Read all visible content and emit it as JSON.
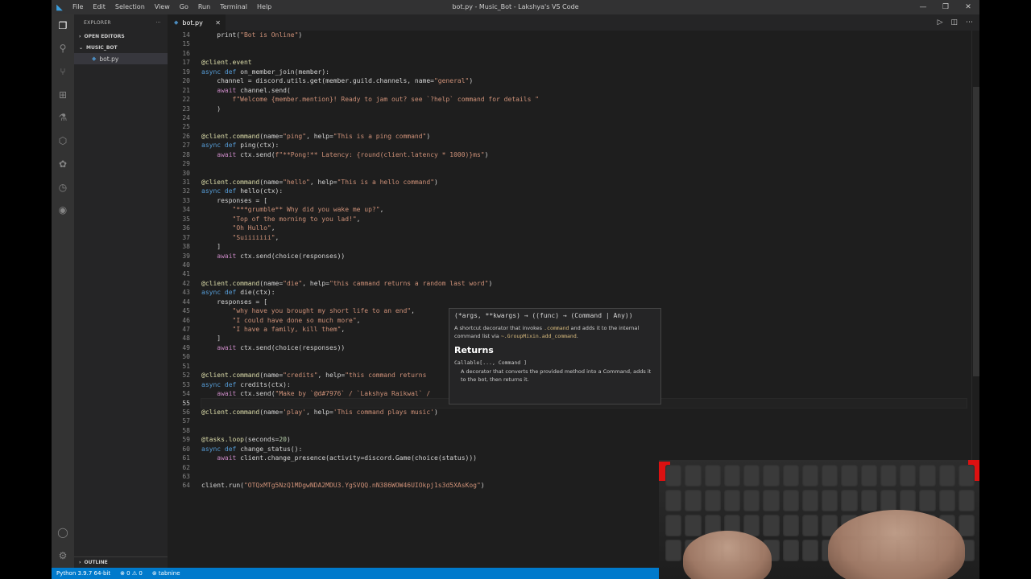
{
  "window": {
    "title": "bot.py - Music_Bot - Lakshya's VS Code",
    "menu": [
      "File",
      "Edit",
      "Selection",
      "View",
      "Go",
      "Run",
      "Terminal",
      "Help"
    ],
    "controls": [
      "—",
      "❐",
      "✕"
    ]
  },
  "activity_icons": [
    "files-icon",
    "search-icon",
    "source-control-icon",
    "extensions-icon",
    "testing-icon",
    "remote-icon",
    "docker-icon",
    "timeline-icon",
    "spotify-icon",
    "account-icon",
    "settings-icon"
  ],
  "sidebar": {
    "title": "EXPLORER",
    "more": "···",
    "open_editors": "OPEN EDITORS",
    "folder": "MUSIC_BOT",
    "file": "bot.py",
    "outline": "OUTLINE"
  },
  "tab": {
    "label": "bot.py",
    "close": "✕"
  },
  "editor": {
    "active_line": 55,
    "line_numbers": [
      "14",
      "15",
      "16",
      "17",
      "19",
      "20",
      "21",
      "22",
      "23",
      "24",
      "25",
      "26",
      "27",
      "28",
      "29",
      "30",
      "31",
      "32",
      "33",
      "34",
      "35",
      "36",
      "37",
      "38",
      "39",
      "40",
      "41",
      "42",
      "43",
      "44",
      "45",
      "46",
      "47",
      "48",
      "49",
      "50",
      "51",
      "52",
      "53",
      "54",
      "55",
      "56",
      "57",
      "58",
      "59",
      "60",
      "61",
      "62",
      "63",
      "64"
    ],
    "lines": [
      "    print(\"Bot is Online\")",
      "",
      "",
      "@client.event",
      "async def on_member_join(member):",
      "    channel = discord.utils.get(member.guild.channels, name=\"general\")",
      "    await channel.send(",
      "        f\"Welcome {member.mention}! Ready to jam out? see `?help` command for details \"",
      "    )",
      "",
      "",
      "@client.command(name=\"ping\", help=\"This is a ping command\")",
      "async def ping(ctx):",
      "    await ctx.send(f\"**Pong!** Latency: {round(client.latency * 1000)}ms\")",
      "",
      "",
      "@client.command(name=\"hello\", help=\"This is a hello command\")",
      "async def hello(ctx):",
      "    responses = [",
      "        \"***grumble** Why did you wake me up?\",",
      "        \"Top of the morning to you lad!\",",
      "        \"Oh Hullo\",",
      "        \"Suiiiiiii\",",
      "    ]",
      "    await ctx.send(choice(responses))",
      "",
      "",
      "@client.command(name=\"die\", help=\"this cammand returns a random last word\")",
      "async def die(ctx):",
      "    responses = [",
      "        \"why have you brought my short life to an end\",",
      "        \"I could have done so much more\",",
      "        \"I have a family, kill them\",",
      "    ]",
      "    await ctx.send(choice(responses))",
      "",
      "",
      "@client.command(name=\"credits\", help=\"this command returns",
      "async def credits(ctx):",
      "    await ctx.send(\"Make by `@d#7976` / `Lakshya Raikwal` /",
      "",
      "@client.command(name='play', help='This command plays music')",
      "",
      "",
      "@tasks.loop(seconds=20)",
      "async def change_status():",
      "    await client.change_presence(activity=discord.Game(choice(status)))",
      "",
      "",
      "client.run(\"OTQxMTg5NzQ1MDgwNDA2MDU3.YgSVQQ.nN386WOW46UIOkpj1s3d5XAsKog\")",
      ""
    ]
  },
  "hover": {
    "signature": "(*args, **kwargs) → ((func) → (Command | Any))",
    "desc_1": "A shortcut decorator that invokes",
    "code_1": ".command",
    "desc_2": "and adds it to the internal command list via",
    "code_2": "~.GroupMixin.add_command",
    "desc_3": ".",
    "returns": "Returns",
    "return_type": "Callable[..., Command ]",
    "return_desc": "A decorator that converts the provided method into a Command, adds it to the bot, then returns it."
  },
  "status": {
    "python": "Python 3.9.7 64-bit",
    "problems": "⊗ 0 ⚠ 0",
    "tabnine": "⊛ tabnine"
  }
}
